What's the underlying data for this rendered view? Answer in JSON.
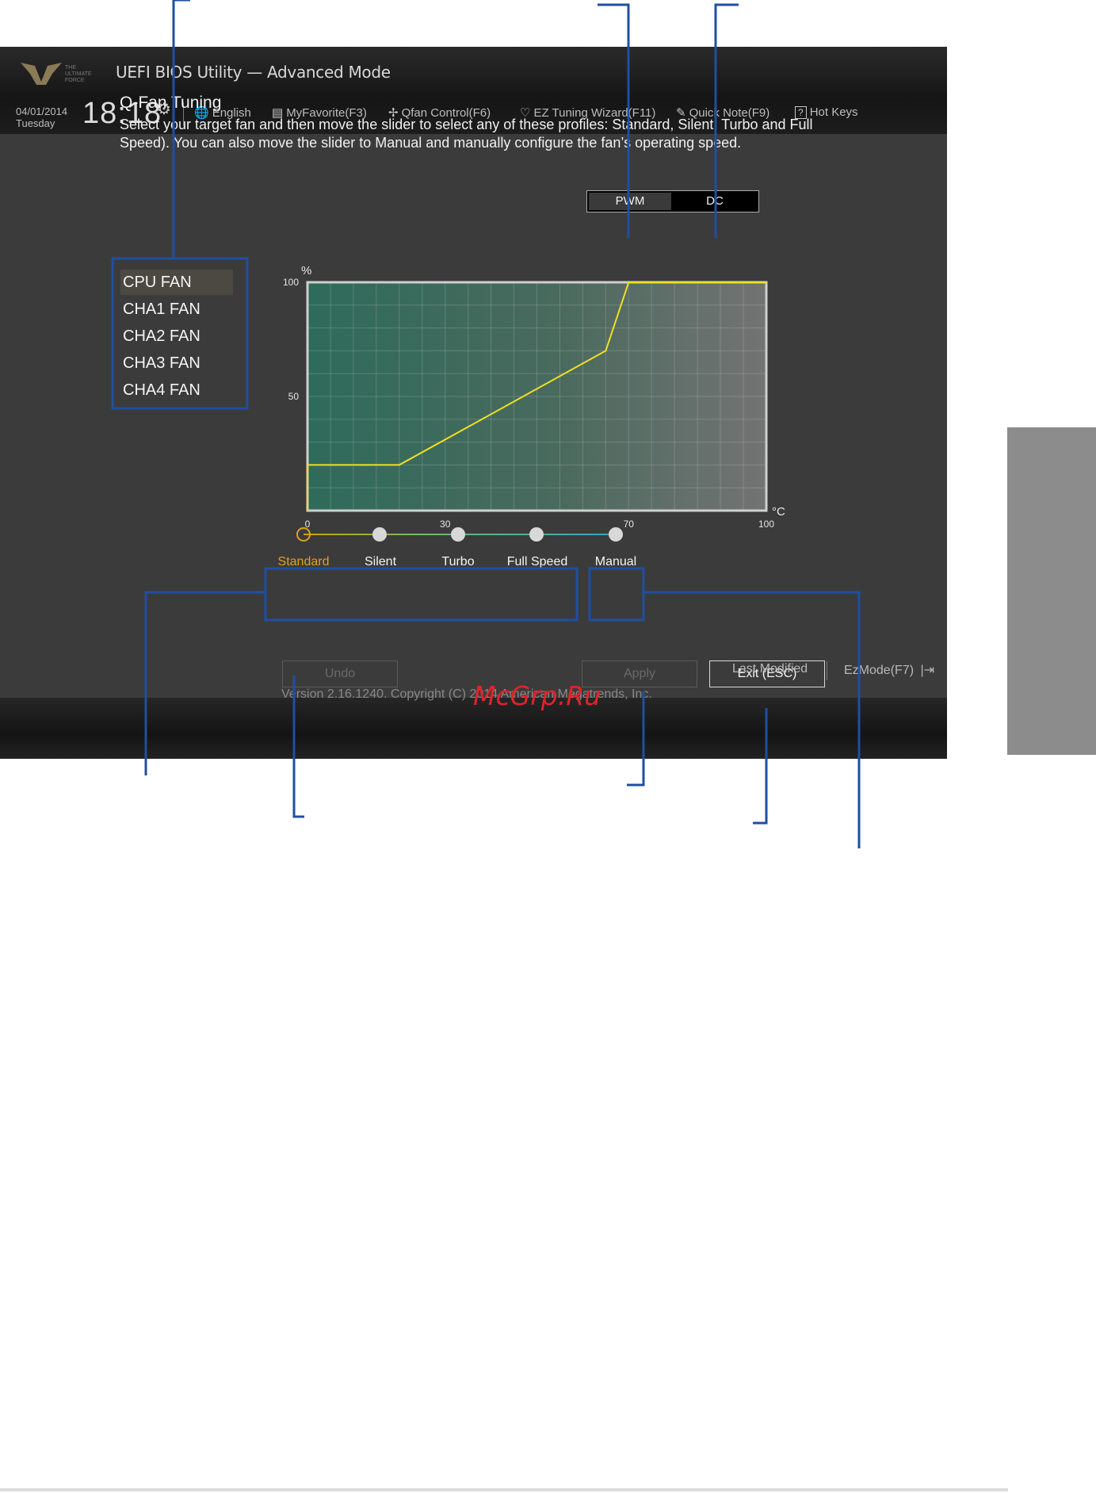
{
  "window": {
    "title": "UEFI BIOS Utility — Advanced Mode"
  },
  "header": {
    "date": "04/01/2014",
    "day": "Tuesday",
    "time": "18:18",
    "toolbar": [
      {
        "label": "English",
        "icon": "globe-icon"
      },
      {
        "label": "MyFavorite(F3)",
        "icon": "favorite-icon"
      },
      {
        "label": "Qfan Control(F6)",
        "icon": "fan-icon"
      },
      {
        "label": "EZ Tuning Wizard(F11)",
        "icon": "bulb-icon"
      },
      {
        "label": "Quick Note(F9)",
        "icon": "note-icon"
      },
      {
        "label": "Hot Keys",
        "icon": "help-icon"
      }
    ]
  },
  "main": {
    "heading": "Q-Fan Tuning",
    "description": "Select your target fan and then move the slider to select any of these profiles: Standard, Silent, Turbo and Full Speed). You can also move the slider to Manual and manually configure the fan’s operating speed.",
    "fans": [
      "CPU FAN",
      "CHA1 FAN",
      "CHA2 FAN",
      "CHA3 FAN",
      "CHA4 FAN"
    ],
    "selected_fan": "CPU FAN",
    "mode_toggle": {
      "pwm": "PWM",
      "dc": "DC",
      "selected": "DC"
    },
    "profiles": [
      "Standard",
      "Silent",
      "Turbo",
      "Full Speed"
    ],
    "manual": "Manual",
    "selected_profile": "Standard",
    "buttons": {
      "undo": "Undo",
      "apply": "Apply",
      "exit": "Exit (ESC)"
    }
  },
  "chart_data": {
    "type": "line",
    "xunit": "°C",
    "yunit": "%",
    "xlim": [
      0,
      100
    ],
    "ylim": [
      0,
      100
    ],
    "x_ticks": [
      "0",
      "30",
      "70",
      "100"
    ],
    "y_ticks": [
      "100",
      "50"
    ],
    "grid": true,
    "series": [
      {
        "x": [
          0,
          0,
          20,
          65,
          70,
          100
        ],
        "y": [
          0,
          20,
          20,
          70,
          100,
          100
        ]
      }
    ],
    "colors": {
      "line": "#f0e020",
      "fill_start": "#2e6b5a",
      "fill_end": "#707070"
    }
  },
  "footer": {
    "last_modified": "Last Modified",
    "ezmode": "EzMode(F7)",
    "version": "Version 2.16.1240. Copyright (C) 2014 American Megatrends, Inc.",
    "watermark": "McGrp.Ru"
  },
  "colors": {
    "callout": "#1f4fa0",
    "accent": "#e0a020"
  }
}
